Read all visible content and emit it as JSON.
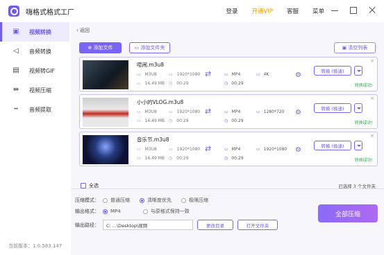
{
  "app": {
    "title": "嗨格式格式工厂"
  },
  "topbar": {
    "login": "登录",
    "vip": "开通VIP",
    "service": "客服",
    "menu": "菜单"
  },
  "sidebar": {
    "items": [
      {
        "label": "视频转换",
        "icon": "video-convert-icon"
      },
      {
        "label": "音频转换",
        "icon": "speaker-icon"
      },
      {
        "label": "视频转GIF",
        "icon": "gif-icon"
      },
      {
        "label": "视频压缩",
        "icon": "compress-icon"
      },
      {
        "label": "音频提取",
        "icon": "audio-extract-icon"
      }
    ]
  },
  "version": "当前版本：1.0.583.147",
  "toolbar": {
    "back": "返回",
    "add_file": "添加文件",
    "add_folder": "添加文件夹",
    "clear_list": "清空列表"
  },
  "files": [
    {
      "name": "喧闹.m3u8",
      "in_format": "M3U8",
      "in_res": "1920*1080",
      "in_size": "16.49 MB",
      "in_dur": "00:29",
      "out_format": "MP4",
      "out_res": "4K",
      "out_dur": "00:29",
      "action": "转换 (极速)",
      "status": "转换成功!"
    },
    {
      "name": "小小的VLOG.m3u8",
      "in_format": "M3U8",
      "in_res": "1920*1080",
      "in_size": "16.49 MB",
      "in_dur": "00:29",
      "out_format": "MP4",
      "out_res": "1280*720",
      "out_dur": "00:29",
      "action": "转换 (极速)",
      "status": "转换成功!"
    },
    {
      "name": "音乐节.m3u8",
      "in_format": "M3U8",
      "in_res": "1920*1080",
      "in_size": "16.49 MB",
      "in_dur": "00:29",
      "out_format": "MP4",
      "out_res": "1920*1080",
      "out_dur": "00:29",
      "action": "转换 (极速)",
      "status": "转换成功!"
    }
  ],
  "list_footer": {
    "select_all": "全选",
    "selected": "已选择 3 个文件夹"
  },
  "options": {
    "compress_mode_label": "压缩模式：",
    "modes": [
      "普通压缩",
      "清晰度优先",
      "极限压缩"
    ],
    "output_format_label": "输出格式：",
    "formats": [
      "MP4",
      "与原格式保持一致"
    ],
    "output_path_label": "输出路径：",
    "path_value": "C: ...\\Desktop\\视频",
    "change_dir": "更改目录",
    "open_folder": "打开文件夹"
  },
  "compress_all": "全部压缩"
}
